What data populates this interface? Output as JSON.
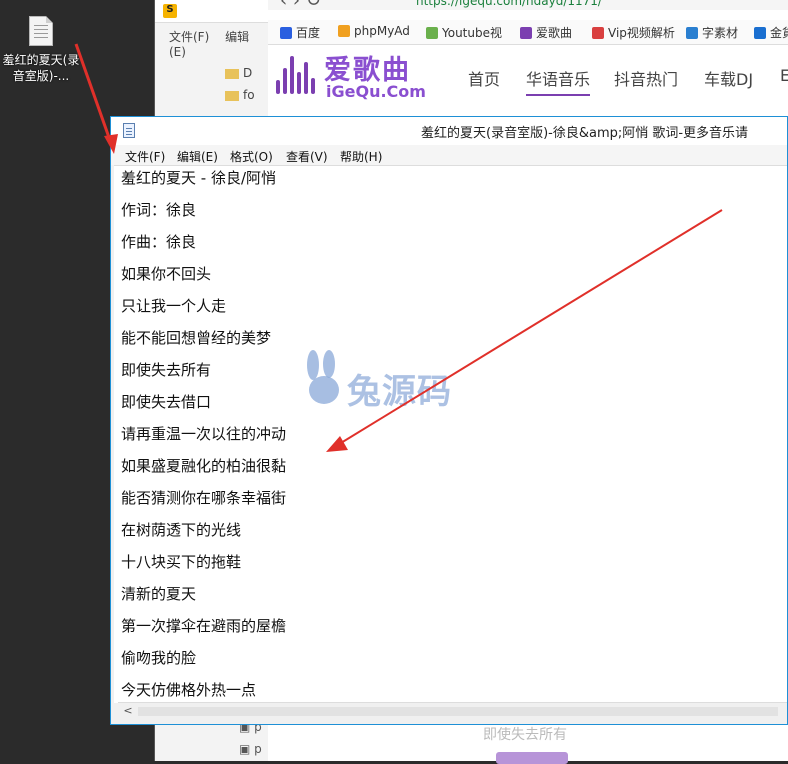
{
  "desktop": {
    "file_label": "羞红的夏天(录音室版)-..."
  },
  "explorer": {
    "menu": [
      "文件(F)",
      "编辑(E)"
    ],
    "tree": [
      "D",
      "fo"
    ],
    "files": [
      "p",
      "p"
    ]
  },
  "browser": {
    "url": "https://igequ.com/hdayd/1171/",
    "bookmarks": [
      "百度",
      "phpMyAd",
      "Youtube视",
      "爱歌曲",
      "Vip视频解析",
      "字素材",
      "金貨"
    ],
    "logo": {
      "cn": "爱歌曲",
      "en": "iGeQu.Com"
    },
    "site_nav": [
      "首页",
      "华语音乐",
      "抖音热门",
      "车载DJ",
      "E"
    ],
    "active_nav": "华语音乐",
    "below_text": "即使失去所有"
  },
  "notepad": {
    "title": "羞红的夏天(录音室版)-徐良&amp;阿悄 歌词-更多音乐请",
    "menu": [
      "文件(F)",
      "编辑(E)",
      "格式(O)",
      "查看(V)",
      "帮助(H)"
    ],
    "lines": [
      "羞红的夏天 - 徐良/阿悄",
      "作词：徐良",
      "作曲：徐良",
      "如果你不回头",
      "只让我一个人走",
      "能不能回想曾经的美梦",
      "即使失去所有",
      "即使失去借口",
      "请再重温一次以往的冲动",
      "如果盛夏融化的柏油很黏",
      "能否猜测你在哪条幸福街",
      "在树荫透下的光线",
      "十八块买下的拖鞋",
      "清新的夏天",
      "第一次撑伞在避雨的屋檐",
      "偷吻我的脸",
      "今天仿佛格外热一点"
    ],
    "scroll_left": "<"
  },
  "watermark": {
    "text": "兔源码"
  },
  "colors": {
    "accent": "#7b3fb0",
    "notepad_border": "#1e90d6",
    "arrow": "#e0302a"
  }
}
